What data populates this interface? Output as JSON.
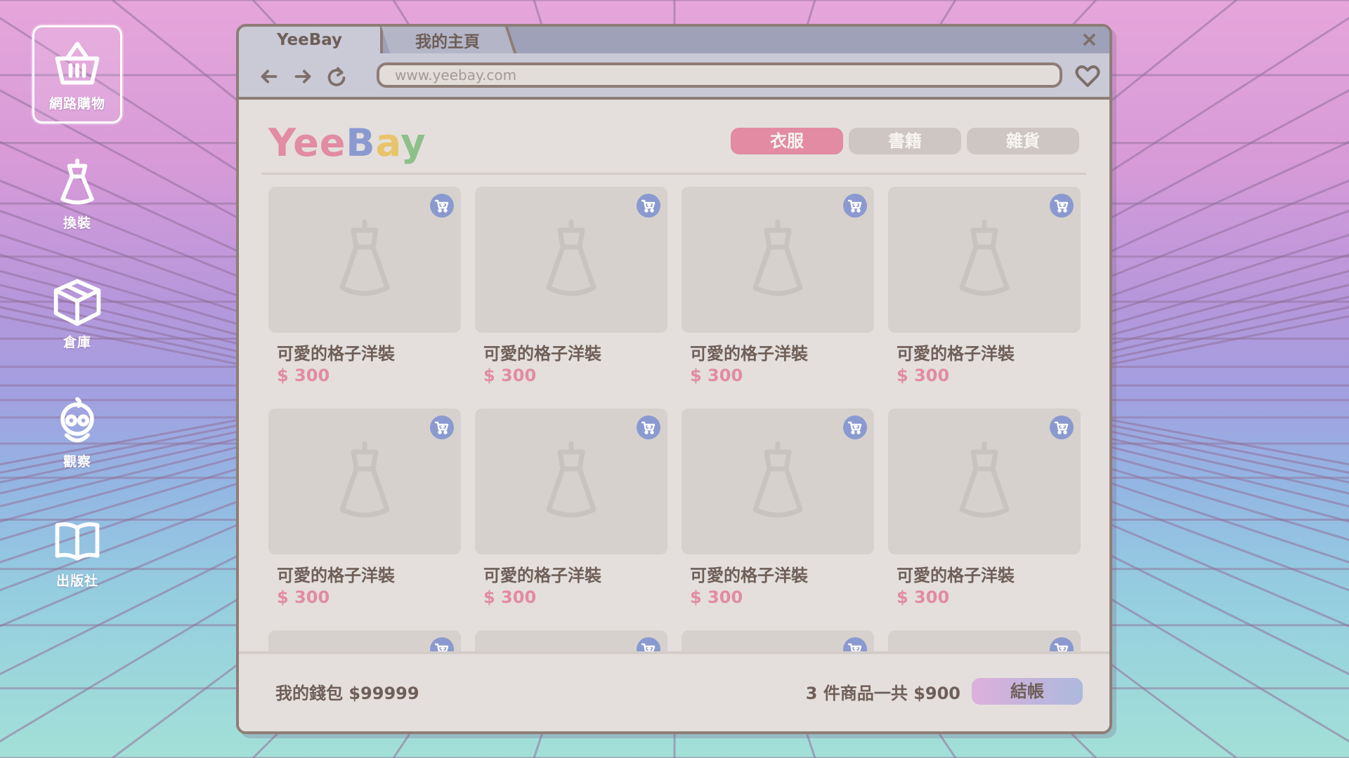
{
  "sidebar": {
    "items": [
      {
        "label": "網路購物",
        "icon": "shopping-basket-icon",
        "active": true
      },
      {
        "label": "換裝",
        "icon": "dress-icon",
        "active": false
      },
      {
        "label": "倉庫",
        "icon": "box-icon",
        "active": false
      },
      {
        "label": "觀察",
        "icon": "character-face-icon",
        "active": false
      },
      {
        "label": "出版社",
        "icon": "open-book-icon",
        "active": false
      }
    ]
  },
  "browser": {
    "tabs": [
      {
        "label": "YeeBay",
        "active": true
      },
      {
        "label": "我的主頁",
        "active": false
      }
    ],
    "close_label": "×",
    "url": "www.yeebay.com"
  },
  "site": {
    "logo_letters": [
      {
        "char": "Y",
        "color": "#e28ba3"
      },
      {
        "char": "e",
        "color": "#e28ba3"
      },
      {
        "char": "e",
        "color": "#e28ba3"
      },
      {
        "char": "B",
        "color": "#8a9ad0"
      },
      {
        "char": "a",
        "color": "#e8c46a"
      },
      {
        "char": "y",
        "color": "#8dc08a"
      }
    ],
    "categories": [
      {
        "label": "衣服",
        "active": true
      },
      {
        "label": "書籍",
        "active": false
      },
      {
        "label": "雜貨",
        "active": false
      }
    ]
  },
  "products": [
    {
      "name": "可愛的格子洋裝",
      "price": "$ 300"
    },
    {
      "name": "可愛的格子洋裝",
      "price": "$ 300"
    },
    {
      "name": "可愛的格子洋裝",
      "price": "$ 300"
    },
    {
      "name": "可愛的格子洋裝",
      "price": "$ 300"
    },
    {
      "name": "可愛的格子洋裝",
      "price": "$ 300"
    },
    {
      "name": "可愛的格子洋裝",
      "price": "$ 300"
    },
    {
      "name": "可愛的格子洋裝",
      "price": "$ 300"
    },
    {
      "name": "可愛的格子洋裝",
      "price": "$ 300"
    },
    {
      "name": "",
      "price": ""
    },
    {
      "name": "",
      "price": ""
    },
    {
      "name": "",
      "price": ""
    },
    {
      "name": "",
      "price": ""
    }
  ],
  "footer": {
    "wallet": "我的錢包 $99999",
    "summary": "3 件商品一共 $900",
    "checkout_label": "結帳"
  },
  "colors": {
    "accent_pink": "#e28ba3",
    "accent_blue": "#8a9ad0",
    "text_brown": "#6f5f58",
    "frame": "#8e7d76"
  }
}
